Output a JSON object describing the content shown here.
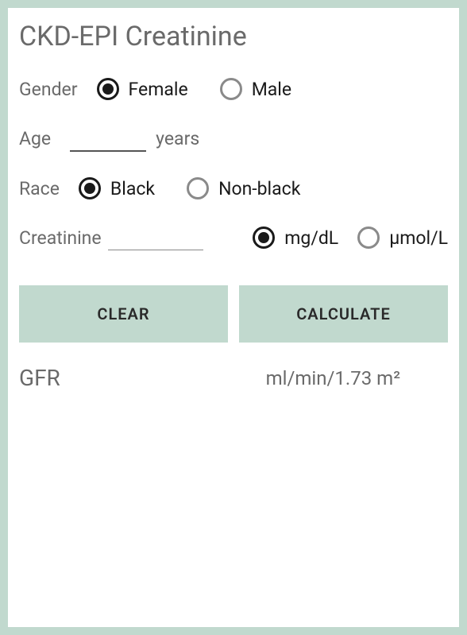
{
  "title": "CKD-EPI Creatinine",
  "gender": {
    "label": "Gender",
    "options": {
      "female": "Female",
      "male": "Male"
    },
    "selected": "female"
  },
  "age": {
    "label": "Age",
    "value": "",
    "unit": "years"
  },
  "race": {
    "label": "Race",
    "options": {
      "black": "Black",
      "nonblack": "Non-black"
    },
    "selected": "black"
  },
  "creatinine": {
    "label": "Creatinine",
    "value": "",
    "units": {
      "mgdl": "mg/dL",
      "umoll": "μmol/L"
    },
    "selected_unit": "mgdl"
  },
  "buttons": {
    "clear": "CLEAR",
    "calculate": "CALCULATE"
  },
  "result": {
    "label": "GFR",
    "value": "",
    "unit": "ml/min/1.73 m²"
  }
}
